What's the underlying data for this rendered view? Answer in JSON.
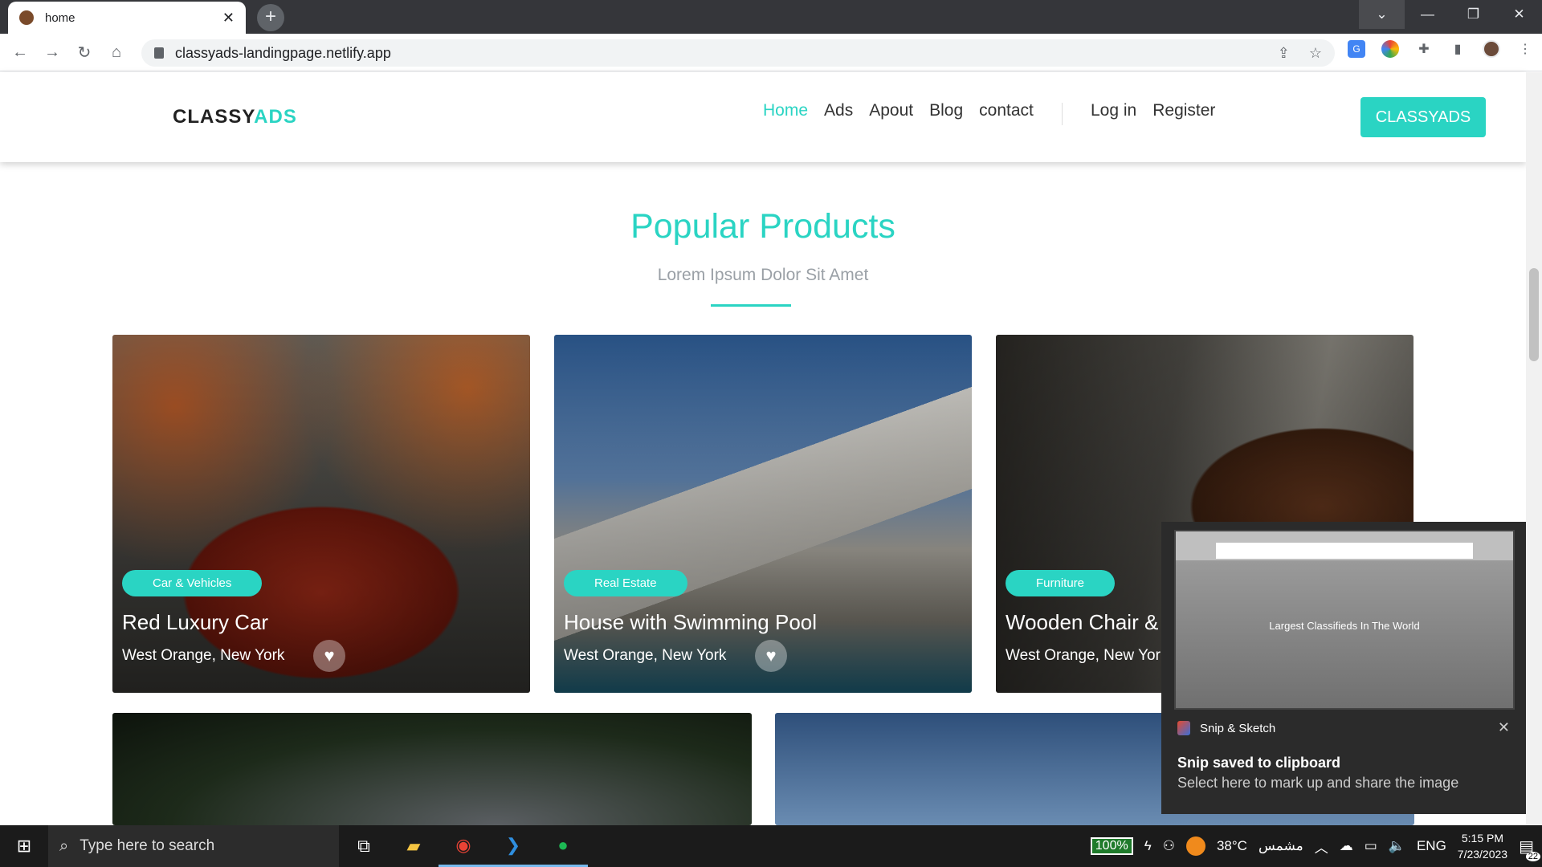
{
  "browser": {
    "tab_title": "home",
    "url": "classyads-landingpage.netlify.app",
    "win_controls": [
      "⌄",
      "—",
      "❐",
      "✕"
    ]
  },
  "site": {
    "logo_main": "CLASSY",
    "logo_accent": "ADS",
    "nav": [
      "Home",
      "Ads",
      "Apout",
      "Blog",
      "contact"
    ],
    "auth": [
      "Log in",
      "Register"
    ],
    "cta": "CLASSYADS",
    "accent_color": "#2ad4c3"
  },
  "section": {
    "title": "Popular Products",
    "subtitle": "Lorem Ipsum Dolor Sit Amet"
  },
  "cards": [
    {
      "badge": "Car & Vehicles",
      "title": "Red Luxury Car",
      "location": "West Orange, New York"
    },
    {
      "badge": "Real Estate",
      "title": "House with Swimming Pool",
      "location": "West Orange, New York"
    },
    {
      "badge": "Furniture",
      "title": "Wooden Chair & Table",
      "location": "West Orange, New York"
    }
  ],
  "toast": {
    "app": "Snip & Sketch",
    "heading": "Snip saved to clipboard",
    "body": "Select here to mark up and share the image",
    "thumb_text": "Largest Classifieds In The World"
  },
  "taskbar": {
    "search_placeholder": "Type here to search",
    "battery": "100%",
    "weather_temp": "38°C",
    "weather_label": "مشمس",
    "lang": "ENG",
    "time": "5:15 PM",
    "date": "7/23/2023",
    "notifications": "22"
  }
}
